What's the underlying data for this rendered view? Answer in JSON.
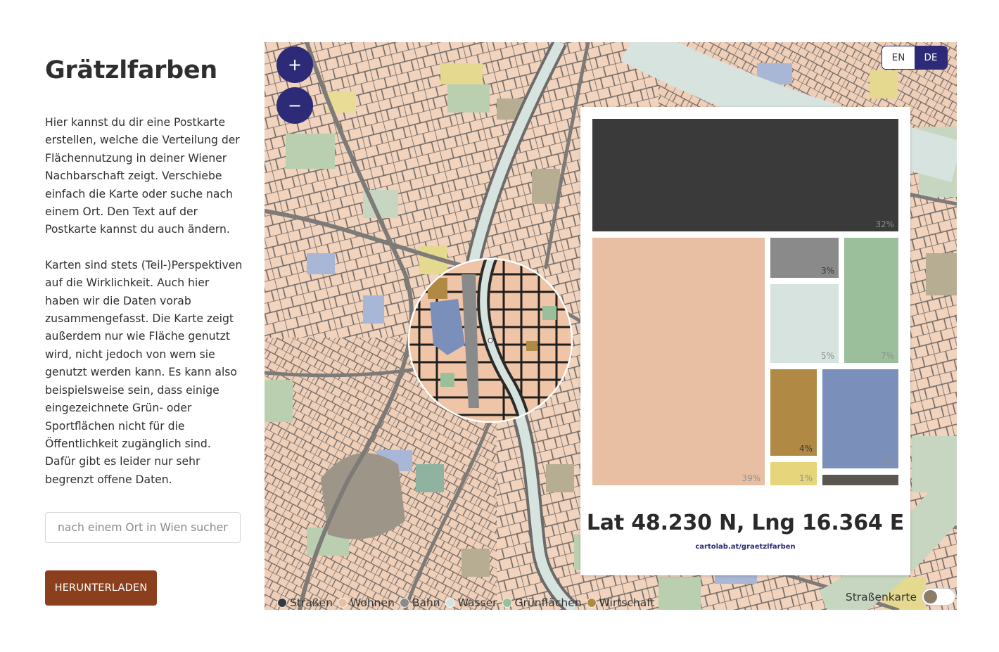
{
  "title": "Grätzlfarben",
  "intro": [
    "Hier kannst du dir eine Postkarte erstellen, welche die Verteilung der Flächennutzung in deiner Wiener Nachbarschaft zeigt. Verschiebe einfach die Karte oder suche nach einem Ort. Den Text auf der Postkarte kannst du auch ändern.",
    "Karten sind stets (Teil-)Perspektiven auf die Wirklichkeit. Auch hier haben wir die Daten vorab zusammengefasst. Die Karte zeigt außerdem nur wie Fläche genutzt wird, nicht jedoch von wem sie genutzt werden kann. Es kann also beispielsweise sein, dass einige eingezeichnete Grün- oder Sportflächen nicht für die Öffentlichkeit zugänglich sind. Dafür gibt es leider nur sehr begrenzt offene Daten."
  ],
  "search": {
    "placeholder": "nach einem Ort in Wien suchen",
    "value": ""
  },
  "download_label": "HERUNTERLADEN",
  "map": {
    "zoom_in": "+",
    "zoom_out": "−",
    "languages": {
      "en": "EN",
      "de": "DE",
      "active": "DE"
    },
    "street_toggle_label": "Straßenkarte",
    "street_toggle_on": false
  },
  "legend": [
    {
      "label": "Straßen",
      "color": "#3b3a3b"
    },
    {
      "label": "Wohnen",
      "color": "#e8bfa2"
    },
    {
      "label": "Bahn",
      "color": "#8a8a8a"
    },
    {
      "label": "Wasser",
      "color": "#d6e3df"
    },
    {
      "label": "Grünflächen",
      "color": "#9bbe9b"
    },
    {
      "label": "Wirtschaft",
      "color": "#b08a45"
    }
  ],
  "postcard": {
    "coords": "Lat 48.230 N, Lng 16.364 E",
    "url": "cartolab.at/graetzlfarben",
    "treemap": [
      {
        "category": "Straßen",
        "label": "32%",
        "color": "#3b3a3b"
      },
      {
        "category": "Wohnen",
        "label": "39%",
        "color": "#e8bfa2"
      },
      {
        "category": "Bahn",
        "label": "3%",
        "color": "#8a8a8a"
      },
      {
        "category": "Wasser",
        "label": "5%",
        "color": "#d6e3df"
      },
      {
        "category": "Grünflächen",
        "label": "7%",
        "color": "#9bbe9b"
      },
      {
        "category": "Wirtschaft",
        "label": "4%",
        "color": "#b08a45"
      },
      {
        "category": "yellow",
        "label": "1%",
        "color": "#e6d57a"
      },
      {
        "category": "blue",
        "label": "7%",
        "color": "#7a8fba"
      },
      {
        "category": "other",
        "label": "",
        "color": "#5c5650"
      }
    ]
  }
}
